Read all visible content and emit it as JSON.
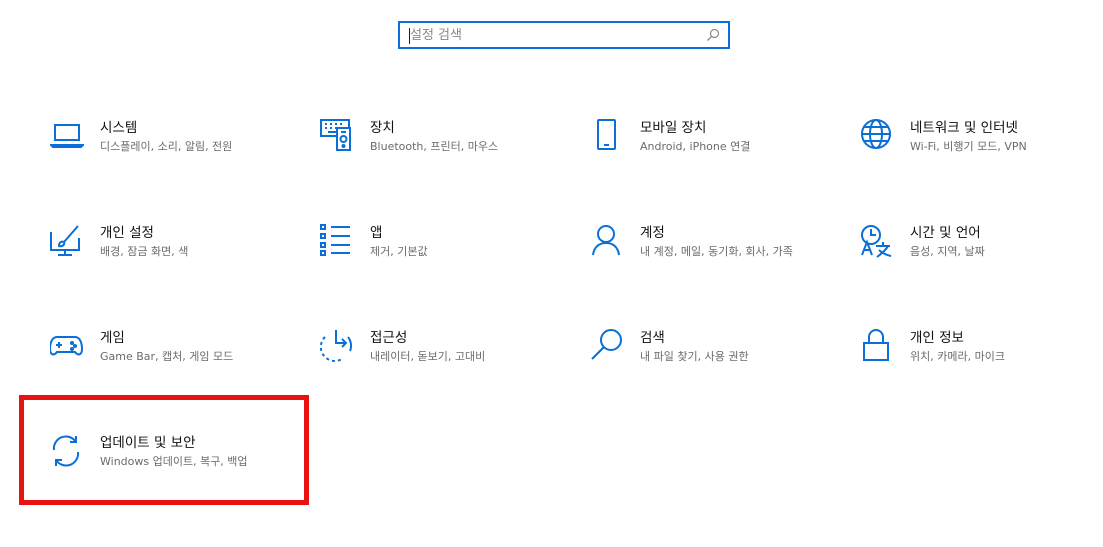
{
  "search": {
    "placeholder": "설정 검색"
  },
  "accent_color": "#0a6fd6",
  "highlight_color": "#e81212",
  "tiles": [
    {
      "title": "시스템",
      "desc": "디스플레이, 소리, 알림, 전원",
      "icon": "laptop-icon"
    },
    {
      "title": "장치",
      "desc": "Bluetooth, 프린터, 마우스",
      "icon": "devices-icon"
    },
    {
      "title": "모바일 장치",
      "desc": "Android, iPhone 연결",
      "icon": "phone-icon"
    },
    {
      "title": "네트워크 및 인터넷",
      "desc": "Wi-Fi, 비행기 모드, VPN",
      "icon": "globe-icon"
    },
    {
      "title": "개인 설정",
      "desc": "배경, 잠금 화면, 색",
      "icon": "personalization-icon"
    },
    {
      "title": "앱",
      "desc": "제거, 기본값",
      "icon": "apps-list-icon"
    },
    {
      "title": "계정",
      "desc": "내 계정, 메일, 동기화, 회사, 가족",
      "icon": "person-icon"
    },
    {
      "title": "시간 및 언어",
      "desc": "음성, 지역, 날짜",
      "icon": "time-language-icon"
    },
    {
      "title": "게임",
      "desc": "Game Bar, 캡처, 게임 모드",
      "icon": "gamepad-icon"
    },
    {
      "title": "접근성",
      "desc": "내레이터, 돋보기, 고대비",
      "icon": "ease-of-access-icon"
    },
    {
      "title": "검색",
      "desc": "내 파일 찾기, 사용 권한",
      "icon": "search-icon"
    },
    {
      "title": "개인 정보",
      "desc": "위치, 카메라, 마이크",
      "icon": "lock-icon"
    },
    {
      "title": "업데이트 및 보안",
      "desc": "Windows 업데이트, 복구, 백업",
      "icon": "sync-icon"
    }
  ]
}
